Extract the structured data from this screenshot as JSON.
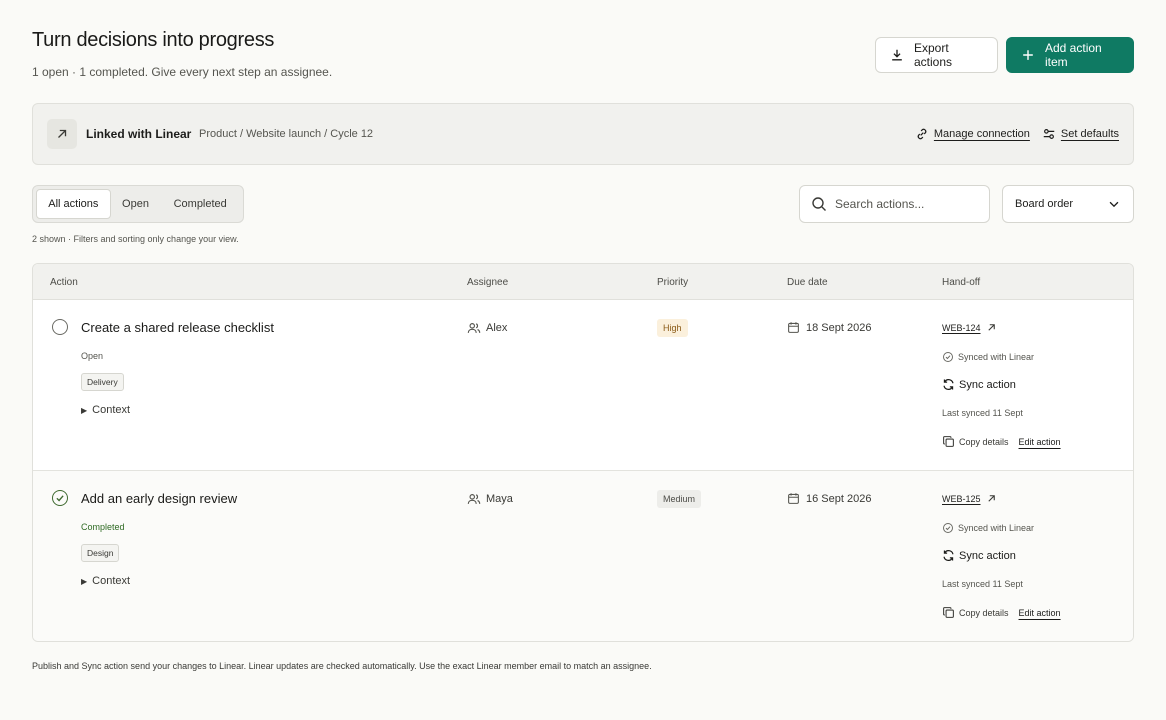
{
  "header": {
    "title": "Turn decisions into progress",
    "subtitle": "1 open · 1 completed. Give every next step an assignee.",
    "export_label": "Export actions",
    "add_label": "Add action item"
  },
  "banner": {
    "title": "Linked with Linear",
    "path": "Product / Website launch / Cycle 12",
    "manage_label": "Manage connection",
    "defaults_label": "Set defaults"
  },
  "filters": {
    "tabs": [
      "All actions",
      "Open",
      "Completed"
    ],
    "active_tab": "All actions",
    "search_placeholder": "Search actions...",
    "sort_value": "Board order",
    "shown_note": "2 shown · Filters and sorting only change your view."
  },
  "table": {
    "columns": [
      "Action",
      "Assignee",
      "Priority",
      "Due date",
      "Hand-off"
    ],
    "rows": [
      {
        "title": "Create a shared release checklist",
        "status": "Open",
        "tag": "Delivery",
        "context_label": "Context",
        "assignee": "Alex",
        "priority": "High",
        "due": "18 Sept 2026",
        "issue": "WEB-124",
        "synced": "Synced with Linear",
        "sync_label": "Sync action",
        "last_synced": "Last synced 11 Sept",
        "copy_label": "Copy details",
        "edit_label": "Edit action"
      },
      {
        "title": "Add an early design review",
        "status": "Completed",
        "tag": "Design",
        "context_label": "Context",
        "assignee": "Maya",
        "priority": "Medium",
        "due": "16 Sept 2026",
        "issue": "WEB-125",
        "synced": "Synced with Linear",
        "sync_label": "Sync action",
        "last_synced": "Last synced 11 Sept",
        "copy_label": "Copy details",
        "edit_label": "Edit action"
      }
    ]
  },
  "footer": {
    "note": "Publish and Sync action send your changes to Linear. Linear updates are checked automatically. Use the exact Linear member email to match an assignee."
  },
  "colors": {
    "accent": "#0f7a63",
    "completed": "#2f6b24",
    "priority_high_bg": "#fbf0dc",
    "priority_high_text": "#8a5a16"
  },
  "icons": [
    "download-icon",
    "plus-icon",
    "arrow-up-right-icon",
    "link-icon",
    "sliders-icon",
    "search-icon",
    "chevron-down-icon",
    "circle-icon",
    "check-circle-icon",
    "caret-right-icon",
    "users-icon",
    "calendar-icon",
    "external-link-icon",
    "check-badge-icon",
    "refresh-icon",
    "copy-icon"
  ]
}
